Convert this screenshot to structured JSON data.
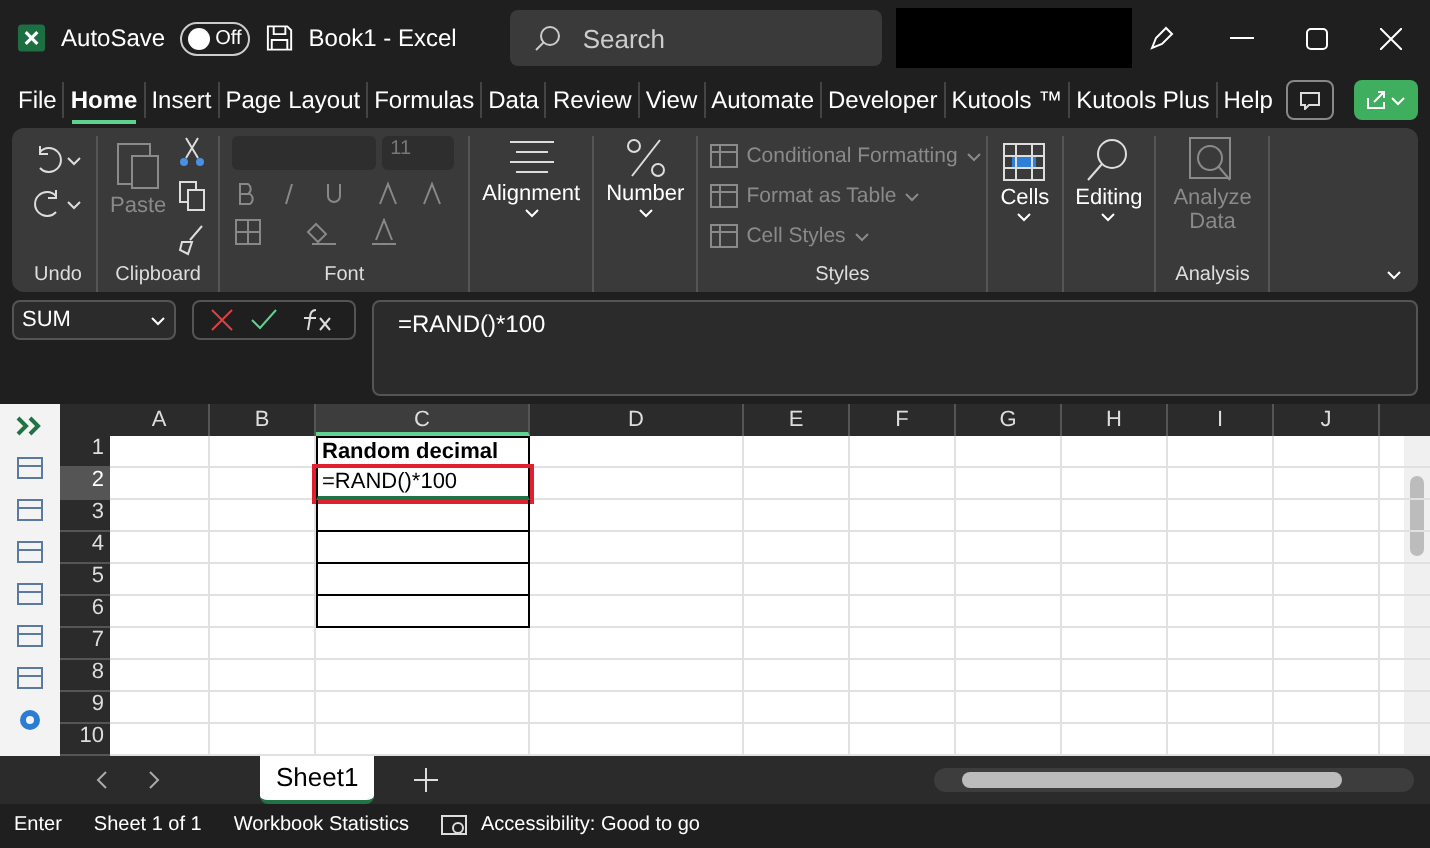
{
  "title_bar": {
    "autosave_label": "AutoSave",
    "autosave": {
      "label": "Off",
      "on": false
    },
    "document": "Book1  -  Excel",
    "search": {
      "placeholder": "Search"
    }
  },
  "menu_tabs": [
    {
      "label": "File",
      "selected": false
    },
    {
      "label": "Home",
      "selected": true
    },
    {
      "label": "Insert",
      "selected": false
    },
    {
      "label": "Page Layout",
      "selected": false
    },
    {
      "label": "Formulas",
      "selected": false
    },
    {
      "label": "Data",
      "selected": false
    },
    {
      "label": "Review",
      "selected": false
    },
    {
      "label": "View",
      "selected": false
    },
    {
      "label": "Automate",
      "selected": false
    },
    {
      "label": "Developer",
      "selected": false
    },
    {
      "label": "Kutools ™",
      "selected": false
    },
    {
      "label": "Kutools Plus",
      "selected": false
    },
    {
      "label": "Help",
      "selected": false
    }
  ],
  "ribbon": {
    "undo": {
      "label": "Undo"
    },
    "clipboard": {
      "paste": {
        "label": "Paste",
        "disabled": true
      },
      "label": "Clipboard"
    },
    "font": {
      "size": "11",
      "label": "Font",
      "disabled": true
    },
    "alignment": {
      "label": "Alignment"
    },
    "number": {
      "label": "Number"
    },
    "styles": {
      "items": [
        {
          "label": "Conditional Formatting",
          "disabled": true
        },
        {
          "label": "Format as Table",
          "disabled": true
        },
        {
          "label": "Cell Styles",
          "disabled": true
        }
      ],
      "label": "Styles"
    },
    "cells": {
      "label": "Cells"
    },
    "editing": {
      "label": "Editing"
    },
    "analysis": {
      "button": {
        "label": "Analyze Data",
        "disabled": true
      },
      "label": "Analysis"
    }
  },
  "formula_bar": {
    "name_box": "SUM",
    "formula": "=RAND()*100"
  },
  "sheet": {
    "columns": [
      {
        "label": "A",
        "selected": false
      },
      {
        "label": "B",
        "selected": false
      },
      {
        "label": "C",
        "selected": true
      },
      {
        "label": "D",
        "selected": false
      },
      {
        "label": "E",
        "selected": false
      },
      {
        "label": "F",
        "selected": false
      },
      {
        "label": "G",
        "selected": false
      },
      {
        "label": "H",
        "selected": false
      },
      {
        "label": "I",
        "selected": false
      },
      {
        "label": "J",
        "selected": false
      }
    ],
    "rows": [
      {
        "label": "1",
        "selected": false,
        "cells": [
          null,
          null,
          {
            "text": "Random decimal",
            "kind": "header",
            "bordered": true,
            "editing": false
          }
        ]
      },
      {
        "label": "2",
        "selected": true,
        "cells": [
          null,
          null,
          {
            "text": "=RAND()*100",
            "kind": "value",
            "bordered": true,
            "editing": true
          }
        ]
      },
      {
        "label": "3",
        "selected": false,
        "cells": [
          null,
          null,
          {
            "kind": "value",
            "bordered": true,
            "editing": false
          }
        ]
      },
      {
        "label": "4",
        "selected": false,
        "cells": [
          null,
          null,
          {
            "kind": "value",
            "bordered": true,
            "editing": false
          }
        ]
      },
      {
        "label": "5",
        "selected": false,
        "cells": [
          null,
          null,
          {
            "kind": "value",
            "bordered": true,
            "editing": false
          }
        ]
      },
      {
        "label": "6",
        "selected": false,
        "cells": [
          null,
          null,
          {
            "kind": "value",
            "bordered": true,
            "editing": false
          }
        ]
      },
      {
        "label": "7",
        "selected": false
      },
      {
        "label": "8",
        "selected": false
      },
      {
        "label": "9",
        "selected": false
      },
      {
        "label": "10",
        "selected": false
      }
    ]
  },
  "sheet_tabs": [
    {
      "label": "Sheet1",
      "selected": true
    }
  ],
  "status_bar": {
    "mode": "Enter",
    "sheet": "Sheet 1 of 1",
    "stats": "Workbook Statistics",
    "accessibility": "Accessibility: Good to go"
  }
}
